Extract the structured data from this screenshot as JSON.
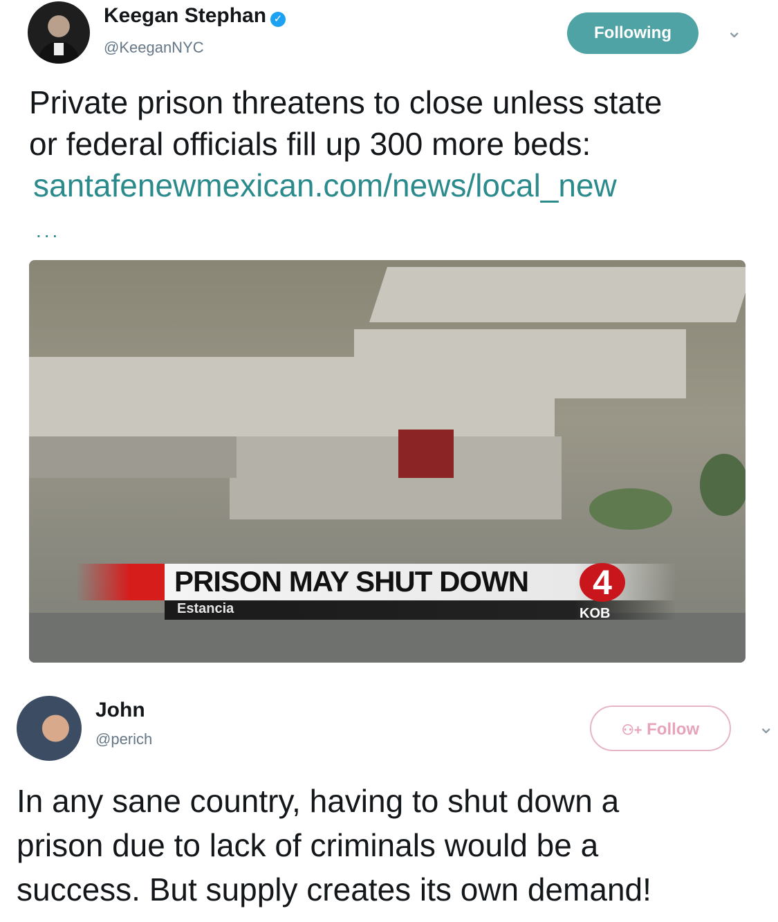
{
  "tweet1": {
    "name": "Keegan Stephan",
    "handle": "@KeeganNYC",
    "follow_state": "Following",
    "text_line1": "Private prison threatens to close unless state",
    "text_line2": "or federal officials fill up 300 more beds:",
    "link": "santafenewmexican.com/news/local_new",
    "ellipsis": "...",
    "image": {
      "headline": "PRISON MAY SHUT DOWN",
      "location": "Estancia",
      "station": "KOB",
      "channel_number": "4"
    }
  },
  "tweet2": {
    "name": "John",
    "handle": "@perich",
    "follow_state": "Follow",
    "text_line1": "In any sane country, having to shut down a",
    "text_line2": "prison due to lack of criminals would be a",
    "text_line3": "success. But supply creates its own demand!"
  },
  "icons": {
    "verified": "✓",
    "chevron": "⌄",
    "add_user": "⚇+"
  },
  "colors": {
    "following_button": "#4fa3a5",
    "link": "#2b8a8c",
    "follow_border": "#e7b5c4",
    "verified": "#1da1f2"
  }
}
